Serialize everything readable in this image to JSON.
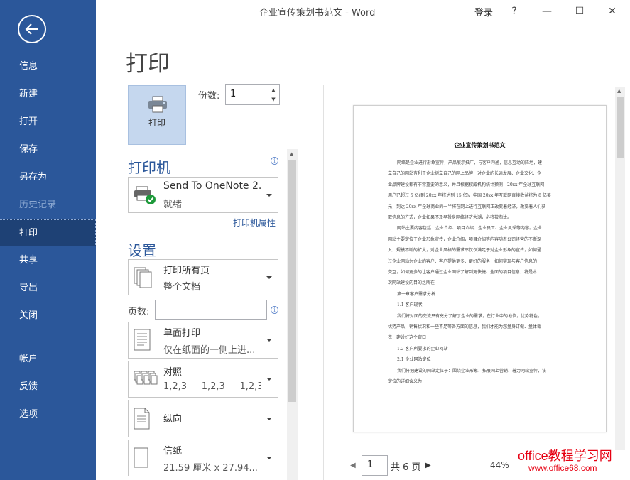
{
  "window": {
    "title": "企业宣传策划书范文  -  Word",
    "login": "登录",
    "help": "?",
    "minimize": "—",
    "maximize": "☐",
    "close": "✕"
  },
  "sidebar": {
    "items": [
      {
        "label": "信息"
      },
      {
        "label": "新建"
      },
      {
        "label": "打开"
      },
      {
        "label": "保存"
      },
      {
        "label": "另存为"
      },
      {
        "label": "历史记录",
        "disabled": true
      },
      {
        "label": "打印",
        "active": true
      },
      {
        "label": "共享"
      },
      {
        "label": "导出"
      },
      {
        "label": "关闭"
      },
      {
        "label": "帐户"
      },
      {
        "label": "反馈"
      },
      {
        "label": "选项"
      }
    ]
  },
  "print": {
    "title": "打印",
    "button_label": "打印",
    "copies_label": "份数:",
    "copies_value": "1"
  },
  "printer": {
    "heading": "打印机",
    "name": "Send To OneNote 2...",
    "status": "就绪",
    "properties_link": "打印机属性"
  },
  "settings": {
    "heading": "设置",
    "range": {
      "line1": "打印所有页",
      "line2": "整个文档"
    },
    "pages_label": "页数:",
    "pages_value": "",
    "sides": {
      "line1": "单面打印",
      "line2": "仅在纸面的一侧上进..."
    },
    "collate": {
      "line1": "对照",
      "line2": "1,2,3     1,2,3     1,2,3"
    },
    "orientation": {
      "line1": "纵向"
    },
    "paper": {
      "line1": "信纸",
      "line2": "21.59 厘米 x 27.94..."
    }
  },
  "preview": {
    "doc_title": "企业宣传策划书范文",
    "lines": [
      "网络是企业进行形象宣传，产品展示推广，与客户沟通，信息互动的阵地，建",
      "立自己的网站有利于企业树立自己的网上品牌，对企业的长远发展、企业文化、企",
      "业品牌建设都有非常重要的意义，并且根据权威机构统计预测：20xx 年全球互联网",
      "用户已超过 5 亿(到 20xx 年将达到 15 亿)，中国 20xx 年互联网直接收益将为 8 亿美",
      "元，到达 20xx 年全球商业的一半将在网上进行互联网正改变着经济，改变着人们获",
      "取信息的方式，企业如果不及早投身网络经济大潮，必将被淘汰。",
      "网站主要内容包括：企业介绍、项目介绍、企业员工、企业风采等内容。企业",
      "网站主要定位于企业形象宣传，企业介绍，项目介绍等内容随着公司经营的不断深",
      "入，规模不断的扩大，对企业风格的需求不仅仅满足于对企业形象的宣传，如何通",
      "过企业网站为企业的客户、客户提供更多、更好的服务，如何实现与客户信息的",
      "交互，如何更多的让客户通过企业网站了解到更快捷、全面的项目信息，将是本",
      "次网站建设的目的之所在",
      "第一章客户需求分析",
      "1.1 客户现状",
      "我们将对面的交流只有充分了解了企业的需求，在行业中的地位，优势特色，",
      "优势产品，销售状况和一些不足等各方面的信息，我们才能为您量身订做、量体裁",
      "衣，建设好这个窗口",
      "1.2 客户所要求的企业网站",
      "2.1 企业网站定位",
      "我们将把建设的网站定位于：围绕企业形象、拓展网上营销、着力网站宣传，该",
      "定位的详细含义为："
    ],
    "page_current": "1",
    "page_total": "共 6 页",
    "zoom": "44%"
  },
  "watermark": {
    "line1": "office教程学习网",
    "line2": "www.office68.com"
  },
  "colors": {
    "sidebar_bg": "#2b579a",
    "sidebar_active": "#1e4175",
    "accent": "#2b579a",
    "watermark": "#e60012"
  }
}
